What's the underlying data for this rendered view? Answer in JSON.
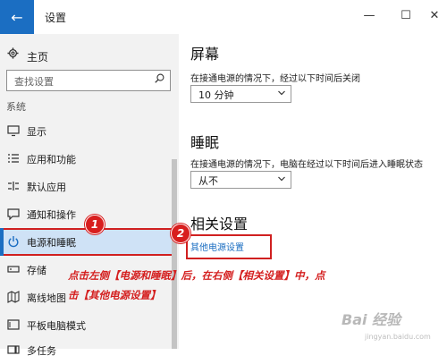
{
  "window": {
    "title": "设置",
    "minimize_glyph": "—",
    "maximize_glyph": "☐",
    "close_glyph": "✕",
    "back_glyph": "←"
  },
  "sidebar": {
    "home_label": "主页",
    "search_placeholder": "查找设置",
    "group_label": "系统",
    "items": [
      {
        "label": "显示",
        "icon": "monitor-icon"
      },
      {
        "label": "应用和功能",
        "icon": "apps-list-icon"
      },
      {
        "label": "默认应用",
        "icon": "default-apps-icon"
      },
      {
        "label": "通知和操作",
        "icon": "notification-icon"
      },
      {
        "label": "电源和睡眠",
        "icon": "power-icon",
        "active": true
      },
      {
        "label": "存储",
        "icon": "storage-icon"
      },
      {
        "label": "离线地图",
        "icon": "map-icon"
      },
      {
        "label": "平板电脑模式",
        "icon": "tablet-icon"
      },
      {
        "label": "多任务",
        "icon": "multitask-icon"
      }
    ]
  },
  "main": {
    "screen": {
      "heading": "屏幕",
      "desc": "在接通电源的情况下，经过以下时间后关闭",
      "value": "10 分钟"
    },
    "sleep": {
      "heading": "睡眠",
      "desc": "在接通电源的情况下，电脑在经过以下时间后进入睡眠状态",
      "value": "从不"
    },
    "related": {
      "heading": "相关设置",
      "link": "其他电源设置"
    }
  },
  "annotations": {
    "badge1": "1",
    "badge2": "2",
    "instruction_line1": "点击左侧【电源和睡眠】后，在右侧【相关设置】中，点",
    "instruction_line2": "击【其他电源设置】",
    "highlight_color": "#d02020"
  },
  "watermark": {
    "text": "Bai 经验",
    "sub": "jingyan.baidu.com"
  },
  "colors": {
    "accent": "#1b6ec2",
    "active_bg": "#cfe2f6",
    "sidebar_bg": "#f2f2f2"
  }
}
